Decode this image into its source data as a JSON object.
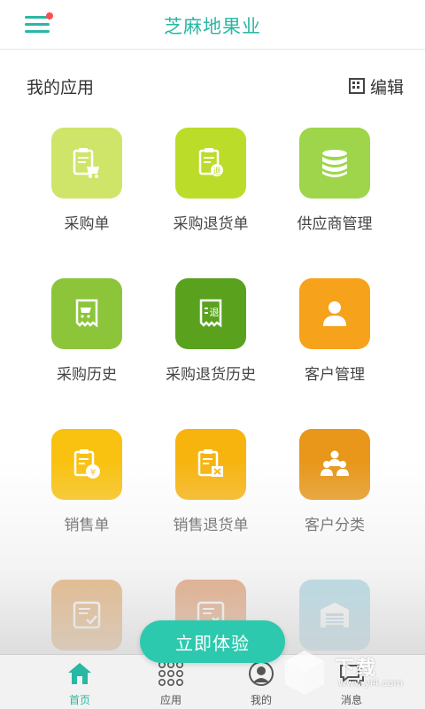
{
  "header": {
    "title": "芝麻地果业",
    "menu_icon": "hamburger-menu-icon",
    "has_notification_dot": true
  },
  "section": {
    "title": "我的应用",
    "edit_label": "编辑",
    "edit_icon": "grid-icon"
  },
  "apps": [
    {
      "label": "采购单",
      "icon": "clipboard-cart-icon",
      "color": "#cfe56a"
    },
    {
      "label": "采购退货单",
      "icon": "clipboard-return-icon",
      "color": "#bcdc2a"
    },
    {
      "label": "供应商管理",
      "icon": "database-icon",
      "color": "#9ed54a"
    },
    {
      "label": "采购历史",
      "icon": "receipt-cart-icon",
      "color": "#8cc53a"
    },
    {
      "label": "采购退货历史",
      "icon": "receipt-return-icon",
      "color": "#5aa21e"
    },
    {
      "label": "客户管理",
      "icon": "person-icon",
      "color": "#f7a21b"
    },
    {
      "label": "销售单",
      "icon": "clipboard-yen-icon",
      "color": "#f9c211"
    },
    {
      "label": "销售退货单",
      "icon": "clipboard-cancel-icon",
      "color": "#f7b40f"
    },
    {
      "label": "客户分类",
      "icon": "group-people-icon",
      "color": "#e8971a"
    },
    {
      "label": "",
      "icon": "inbox-check-icon",
      "color": "#d9801f"
    },
    {
      "label": "",
      "icon": "inbox-cancel-icon",
      "color": "#d5661c"
    },
    {
      "label": "",
      "icon": "warehouse-icon",
      "color": "#7fc4d9"
    }
  ],
  "cta": {
    "label": "立即体验"
  },
  "nav": [
    {
      "label": "首页",
      "icon": "home-icon",
      "active": true
    },
    {
      "label": "应用",
      "icon": "dots-grid-icon",
      "active": false
    },
    {
      "label": "我的",
      "icon": "user-circle-icon",
      "active": false
    },
    {
      "label": "消息",
      "icon": "message-icon",
      "active": false
    }
  ],
  "watermark": {
    "text": "下载",
    "url": "www.yi4.com"
  },
  "colors": {
    "accent": "#29b8a3",
    "cta": "#2dc9ae",
    "notification": "#ff4d4d"
  }
}
